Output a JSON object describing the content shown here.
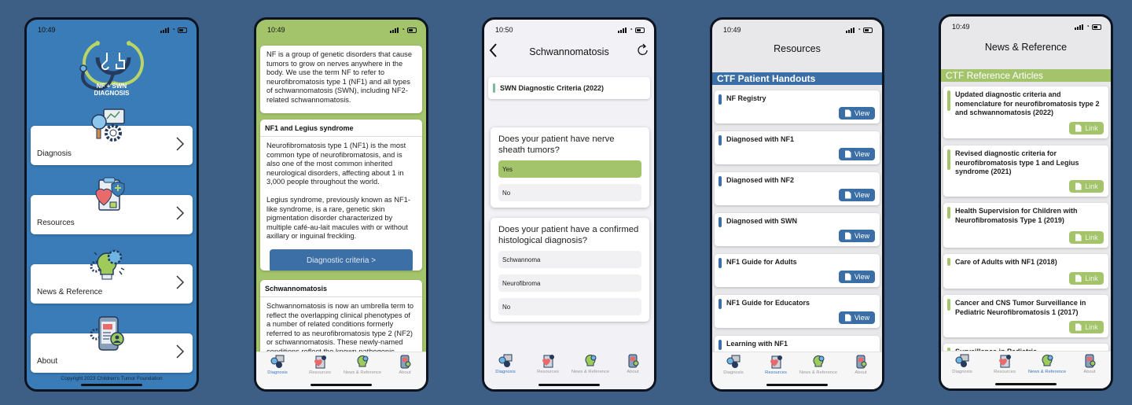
{
  "screens": [
    {
      "id": "home",
      "status_time": "10:49",
      "logo_text": [
        "NF + SWN",
        "DIAGNOSIS"
      ],
      "menu": [
        {
          "label": "Diagnosis",
          "icon": "diagnosis-icon"
        },
        {
          "label": "Resources",
          "icon": "resources-icon"
        },
        {
          "label": "News & Reference",
          "icon": "news-reference-icon"
        },
        {
          "label": "About",
          "icon": "about-icon"
        }
      ],
      "copyright": "Copyright 2023 Children's Tumor Foundation"
    },
    {
      "id": "diagnosis",
      "status_time": "10:49",
      "intro": "NF is a group of genetic disorders that cause tumors to grow on nerves anywhere in the body. We use the term NF to refer to neurofibromatosis type 1 (NF1) and all types of schwannomatosis (SWN), including NF2-related schwannomatosis.",
      "sections": [
        {
          "title": "NF1 and Legius syndrome",
          "paragraphs": [
            "Neurofibromatosis type 1 (NF1) is the most common type of neurofibromatosis, and is also one of the most common inherited neurological disorders, affecting about 1 in 3,000 people throughout the world.",
            "Legius syndrome, previously known as NF1-like syndrome, is a rare, genetic skin pigmentation disorder characterized by multiple café-au-lait macules with or without axillary or inguinal freckling."
          ],
          "button": "Diagnostic criteria >"
        },
        {
          "title": "Schwannomatosis",
          "paragraphs": [
            "Schwannomatosis is now an umbrella term to reflect the overlapping clinical phenotypes of a number of related conditions formerly referred to as neurofibromatosis type 2 (NF2) or schwannomatosis. These newly-named conditions reflect the known pathogenic variant and include"
          ]
        }
      ],
      "active_tab": 0
    },
    {
      "id": "schwannomatosis",
      "status_time": "10:50",
      "title": "Schwannomatosis",
      "criteria": "SWN Diagnostic Criteria (2022)",
      "questions": [
        {
          "question": "Does your patient have nerve sheath tumors?",
          "options": [
            "Yes",
            "No"
          ],
          "selected": "Yes"
        },
        {
          "question": "Does your patient have a confirmed histological diagnosis?",
          "options": [
            "Schwannoma",
            "Neurofibroma",
            "No"
          ],
          "selected": null
        }
      ],
      "active_tab": 0
    },
    {
      "id": "resources",
      "status_time": "10:49",
      "title": "Resources",
      "section": "CTF Patient Handouts",
      "button_label": "View",
      "items": [
        "NF Registry",
        "Diagnosed with NF1",
        "Diagnosed with NF2",
        "Diagnosed with SWN",
        "NF1 Guide for Adults",
        "NF1 Guide for Educators",
        "Learning with NF1"
      ],
      "active_tab": 1
    },
    {
      "id": "news",
      "status_time": "10:49",
      "title": "News & Reference",
      "section": "CTF Reference Articles",
      "button_label": "Link",
      "items": [
        "Updated diagnostic criteria and nomenclature for neurofibromatosis type 2 and schwannomatosis (2022)",
        "Revised diagnostic criteria for neurofibromatosis type 1 and Legius syndrome (2021)",
        "Health Supervision for Children with Neurofibromatosis Type 1 (2019)",
        "Care of Adults with NF1 (2018)",
        "Cancer and CNS Tumor Surveillance in Pediatric Neurofibromatosis 1 (2017)",
        "Surveillance in Pediatric"
      ],
      "active_tab": 2
    }
  ],
  "tabs": [
    "Diagnosis",
    "Resources",
    "News & Reference",
    "About"
  ],
  "colors": {
    "background": "#3d5f85",
    "home_blue": "#3a7cb7",
    "accent_green": "#a4c46c",
    "accent_blue": "#3a6ea5",
    "tab_active": "#3a78c2"
  }
}
